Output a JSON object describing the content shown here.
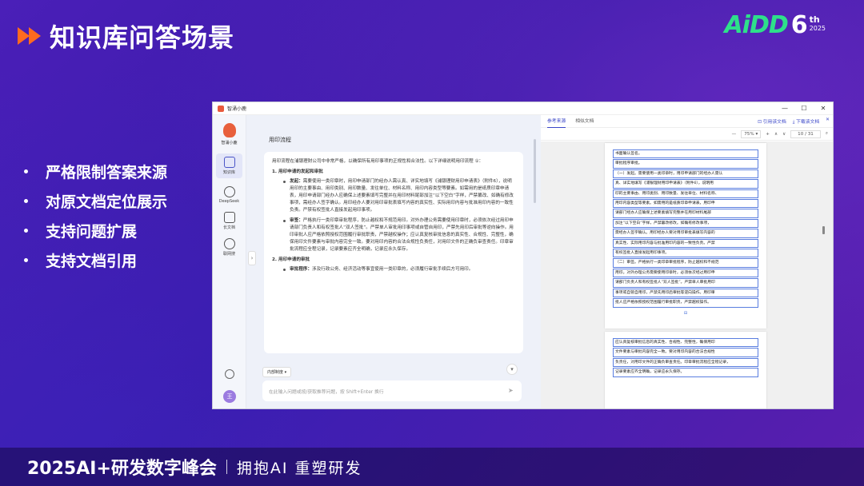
{
  "slide": {
    "title": "知识库问答场景",
    "logo": {
      "main": "AiDD",
      "num": "6",
      "sup": "th",
      "year": "2025"
    },
    "bullets": [
      "严格限制答案来源",
      "对原文档定位展示",
      "支持问题扩展",
      "支持文档引用"
    ],
    "footer": {
      "brand": "2025AI+研发数字峰会",
      "slogan": "拥抱AI 重塑研发"
    }
  },
  "app": {
    "window_title": "智涌小鹿",
    "controls": [
      "—",
      "☐",
      "✕"
    ],
    "brand_name": "智涌小鹿",
    "nav": [
      {
        "label": "知识库",
        "active": true
      },
      {
        "label": "DeepSeek",
        "active": false
      },
      {
        "label": "长文档",
        "active": false
      },
      {
        "label": "联网搜",
        "active": false
      }
    ],
    "avatar": "王",
    "chat": {
      "question": "用印流程",
      "answer_intro": "用印流程在浦银理财公司中非常严格，以确保所有用印事项的正规性和合法性。以下详细说明用印流程 ①：",
      "section1_title": "1. 用印申请的发起和审批",
      "s1_item1_head": "发起：",
      "s1_item1_text": "需要使用一类印章时，用印申请部门的经办人需认真、详实地填写《浦银理财用印申请表》（附件6），说明用印的主要事由、用印类别、用印数量、发往单位、材料名称、用印内容类型等要素。如需用的是纸质印章申请表，用印申请部门经办人应确保上述要素填写完整并在用印材料尾部加注“以下空白”字样，严禁篡改、如确有修改事项，需经办人签字确认。用印经办人要对用印审批表填写内容的真实性、实际用印内容与批准用印内容的一致性负责。严禁有权签批人直接发起用印事项。",
      "s1_item2_head": "审签：",
      "s1_item2_text": "严格执行一类印章审批程序，防止越权和不规范用印。对外办理公务需要使用印章时，必须依次经过用印申请部门负责人和有权签批人“双人签批”。严禁单人审批用印事项或自管自用印，严禁先用印后审批等逆向操作。用印审批人应严格依照授权范围履行审批职责，严禁越权操作；应认真复核审批信息的真实性、合规性、完整性，确保用印文件要素与审批内容完全一致。要对用印内容的合法合规性负责任，对用印文件的正确负审查责任。印章审批流程应全程记录，记录要素应齐全明确，记录应永久保存。",
      "section2_title": "2. 用印申请的审批",
      "s2_item1_head": "审批程序：",
      "s2_item1_text": "涉及行政公务、经济活动等事宜使用一类印章的，必须履行审批手续后方可用印。",
      "chip": "内部制度 ▾",
      "input_placeholder": "在此输入问题或按/获取推荐问题，按 Shift+Enter 换行"
    },
    "doc": {
      "tabs": [
        "参考来源",
        "相似文档"
      ],
      "actions": [
        "⊡ 引用该文档",
        "⤓ 下载该文档",
        "✕"
      ],
      "toolbar": {
        "minus": "—",
        "zoom": "75% ▾",
        "plus": "+",
        "up": "∧",
        "down": "∨",
        "page": "10 / 31",
        "search": "⌕"
      },
      "page1_lines": [
        "书面确认签名。",
        "审批程序审批。",
        "（一）发起。需要使用一类印章时，用印申请部门的经办人需认",
        "真、详实地填写《浦银理财用印申请表》（附件6），说明用",
        "印的主要事由、用印类别、用印数量、发往单位、材料名称、",
        "用印内容类型等要素。如需用的是纸质印章申请表，用印申",
        "请部门经办人应确保上述要素填写完整并在用印材料尾部",
        "加注“以下空白”字样，严禁篡改修改。如确有修改事项，",
        "需经办人签字确认。用印经办人要对用印审批表填写内容的",
        "真实性、实际用印内容与批准用印内容的一致性负责。严禁",
        "有权签批人直接发起用印事项。",
        "（二）审签。严格执行一类印章审批程序，防止越权和不规范",
        "用印。对外办理公务需要使用印章时，必须依次经过用印申",
        "请部门负责人和有权签批人“双人签批”。严禁单人审批用印",
        "事项或自管自用印，严禁先用印后审批等逆向操作。用印审",
        "批人应严格依照授权范围履行审批职责，严禁越权操作。"
      ],
      "page_marker": "⊟",
      "page2_lines": [
        "应认真复核审批信息的真实性、合规性、完整性，确保用印",
        "文件要素与审批内容完全一致。要对用印内容的合法合规性",
        "负责任，对用印文件的正确负审查责任。印章审批流程应全程记录，",
        "记录要素应齐全明确，记录应永久保存。"
      ]
    }
  }
}
